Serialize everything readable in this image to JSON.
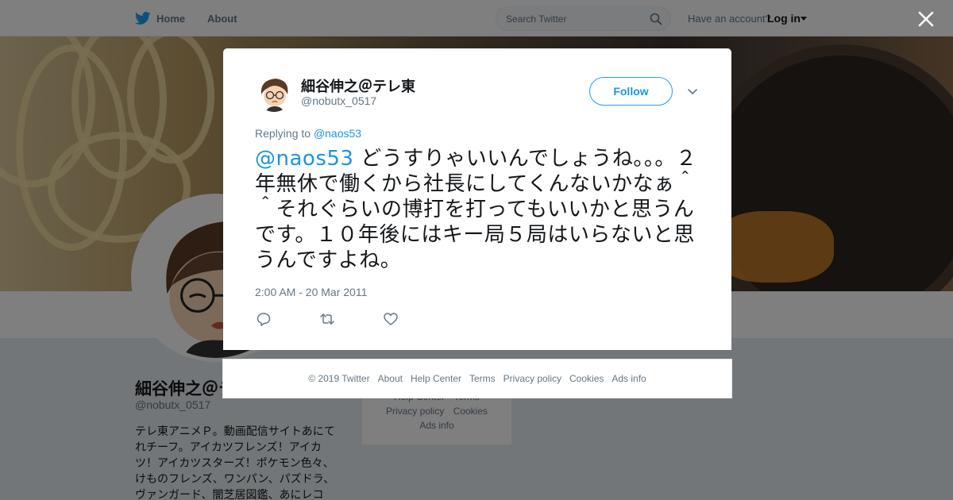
{
  "colors": {
    "accent": "#1da1f2",
    "link": "#1b95e0",
    "secondary_text": "#657786",
    "overlay": "rgba(0,0,0,0.5)"
  },
  "topbar": {
    "home_label": "Home",
    "about_label": "About",
    "search_placeholder": "Search Twitter",
    "account_prompt": "Have an account?",
    "login_label": "Log in"
  },
  "profile": {
    "name": "細谷伸之＠テレ東",
    "handle": "@nobutx_0517",
    "bio": "テレ東アニメＰ。動画配信サイトあにてれチーフ。アイカツフレンズ！アイカツ！アイカツスターズ！ポケモン色々、けものフレンズ、ワンパン、パズドラ、ヴァンガード、闇芝居図鑑、あにレコ"
  },
  "background_links": {
    "row1": [
      "Help Center",
      "Terms"
    ],
    "row2": [
      "Privacy policy",
      "Cookies"
    ],
    "row3": [
      "Ads info"
    ]
  },
  "tweet": {
    "author_name": "細谷伸之＠テレ東",
    "author_handle": "@nobutx_0517",
    "follow_label": "Follow",
    "replying_prefix": "Replying to",
    "replying_to": "@naos53",
    "mention": "@naos53",
    "text": " どうすりゃいいんでしょうね。。。２年無休で働くから社長にしてくんないかなぁ＾＾それぐらいの博打を打ってもいいかと思うんです。１０年後にはキー局５局はいらないと思うんですよね。",
    "timestamp": "2:00 AM - 20 Mar 2011",
    "actions": [
      "reply-icon",
      "retweet-icon",
      "like-icon"
    ]
  },
  "footer": {
    "copyright": "© 2019 Twitter",
    "links": [
      "About",
      "Help Center",
      "Terms",
      "Privacy policy",
      "Cookies",
      "Ads info"
    ]
  }
}
